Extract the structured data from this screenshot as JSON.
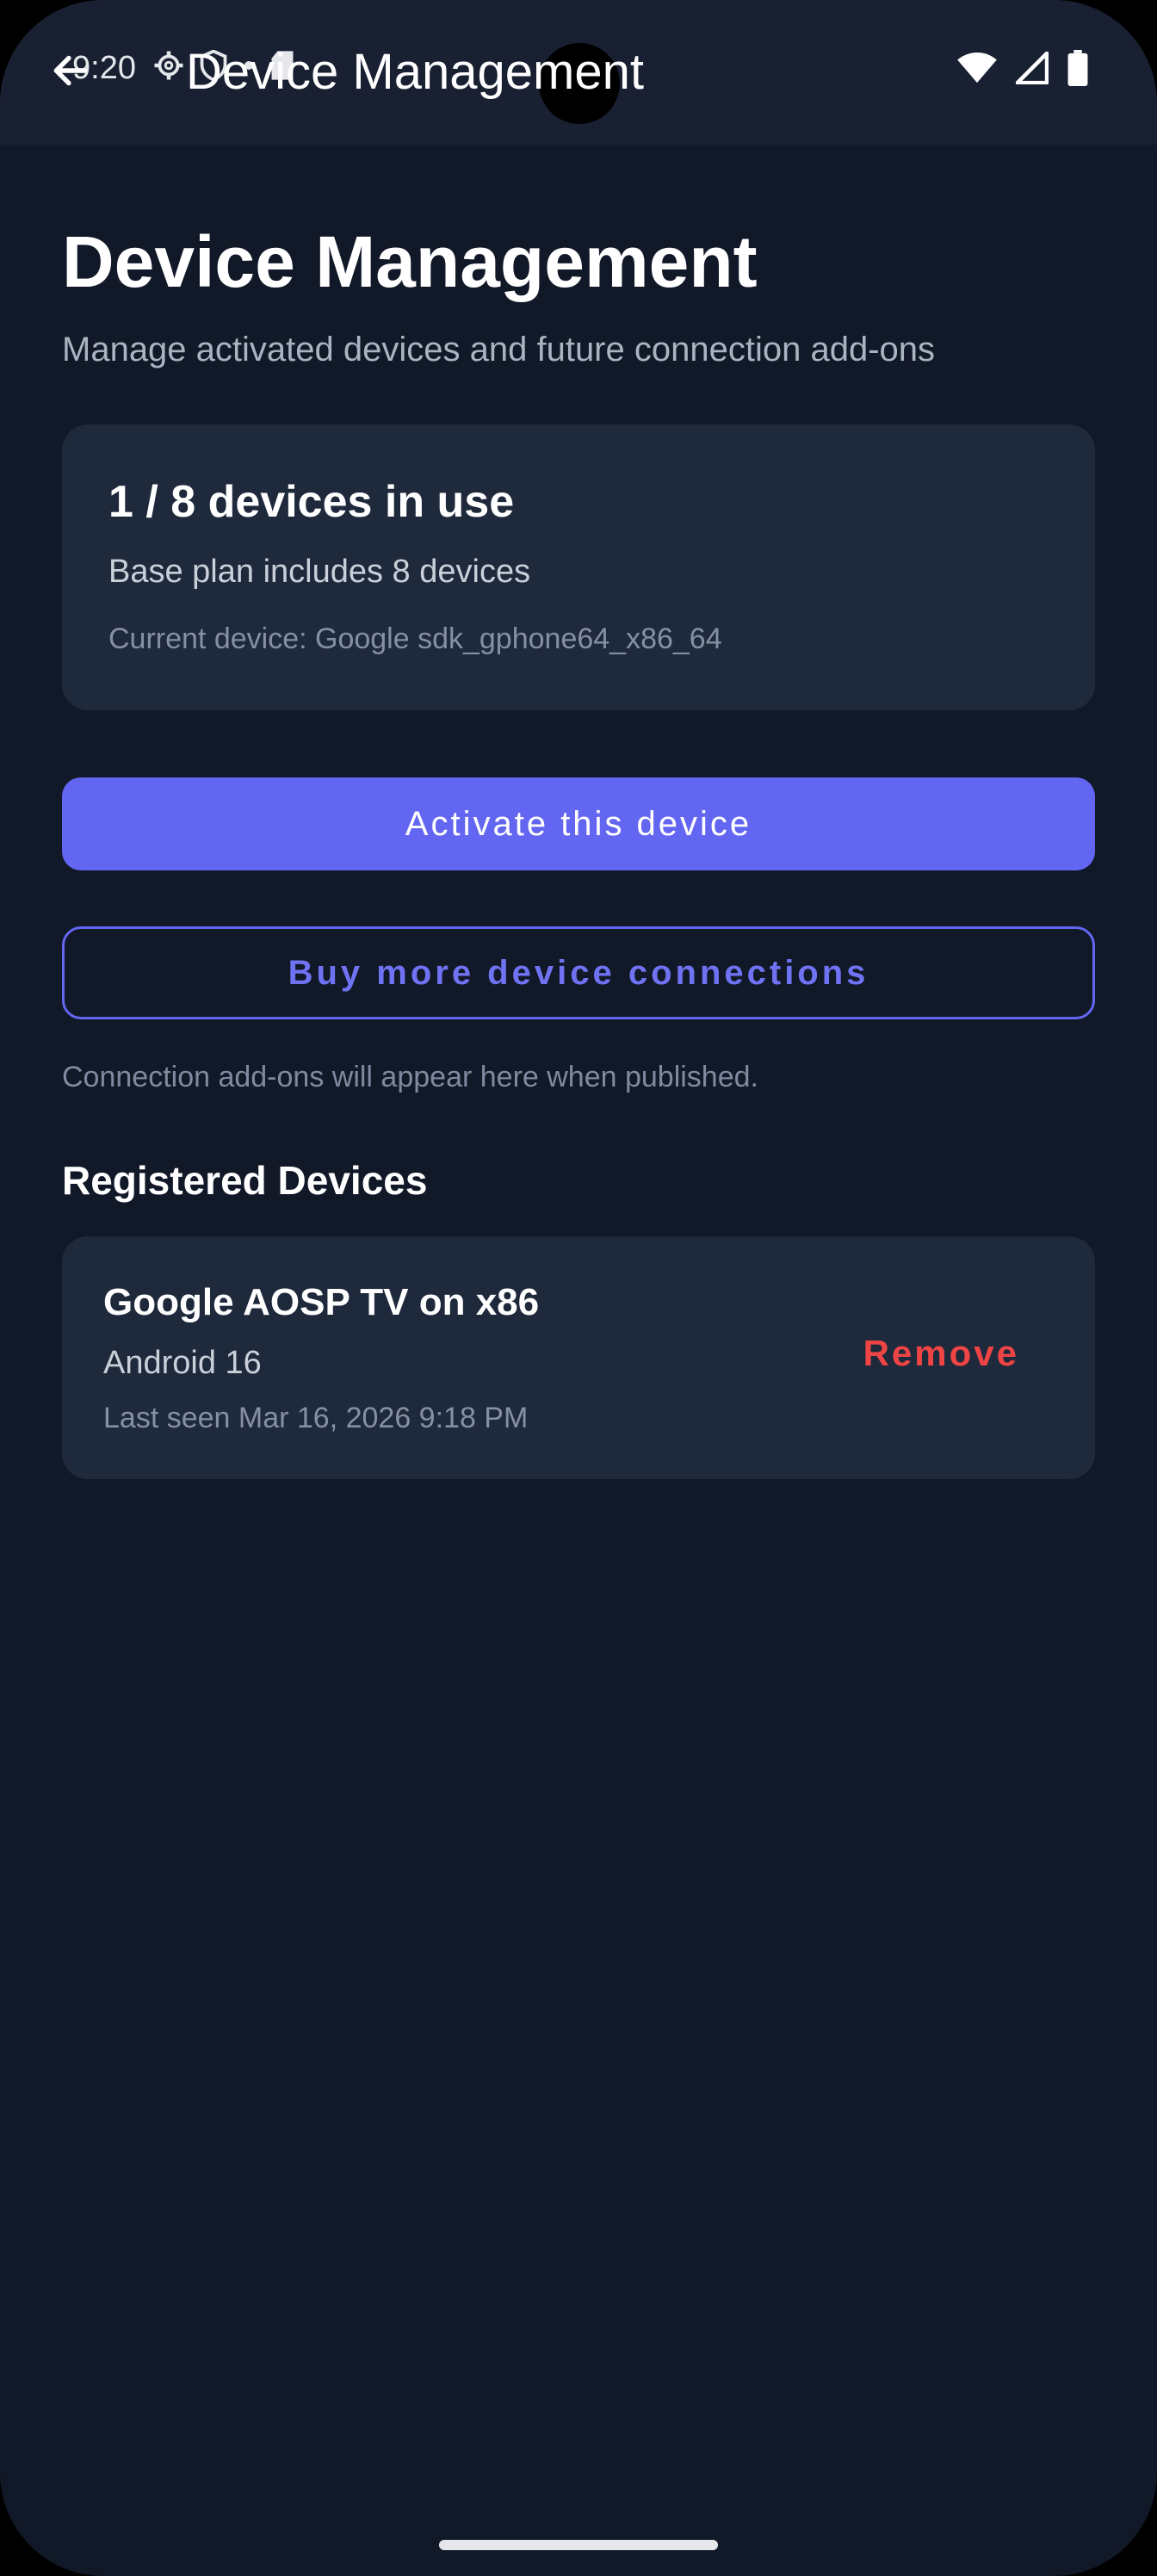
{
  "status_bar": {
    "time": "9:20",
    "left_icons": [
      "gear-icon",
      "shield-icon",
      "dot-icon",
      "sd-card-icon"
    ],
    "right_icons": [
      "wifi-icon",
      "signal-icon",
      "battery-icon"
    ]
  },
  "app_bar": {
    "title": "Device Management",
    "back_icon": "arrow-left-icon"
  },
  "header": {
    "title": "Device Management",
    "subtitle": "Manage activated devices and future connection add-ons"
  },
  "usage": {
    "heading": "1 / 8 devices in use",
    "plan": "Base plan includes 8 devices",
    "current_device": "Current device: Google sdk_gphone64_x86_64",
    "used": 1,
    "total": 8
  },
  "actions": {
    "activate_label": "Activate this device",
    "buy_more_label": "Buy more device connections",
    "addons_note": "Connection add-ons will appear here when published."
  },
  "registered": {
    "heading": "Registered Devices",
    "devices": [
      {
        "name": "Google AOSP TV on x86",
        "os": "Android 16",
        "last_seen": "Last seen Mar 16, 2026 9:18 PM",
        "remove_label": "Remove"
      }
    ]
  },
  "colors": {
    "background": "#111827",
    "card": "#1e293b",
    "accent": "#6366f1",
    "danger": "#ef4444"
  }
}
